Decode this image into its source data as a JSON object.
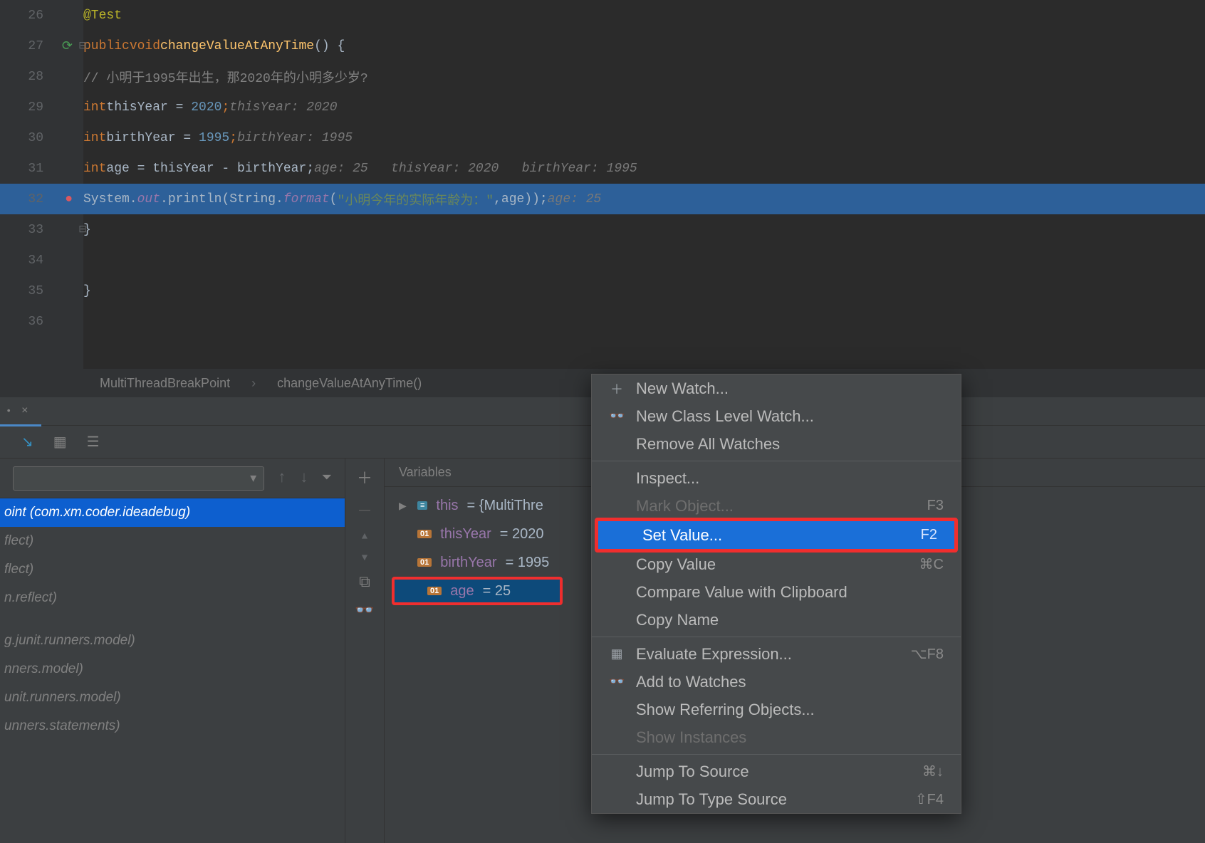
{
  "gutter": {
    "lines": [
      "26",
      "27",
      "28",
      "29",
      "30",
      "31",
      "32",
      "33",
      "34",
      "35",
      "36"
    ]
  },
  "code": {
    "l26": "@Test",
    "l27_kw1": "public",
    "l27_kw2": "void",
    "l27_fn": "changeValueAtAnyTime",
    "l27_tail": "() {",
    "l28_com": "// 小明于1995年出生，那2020年的小明多少岁?",
    "l29_kw": "int",
    "l29_id": "thisYear = ",
    "l29_num": "2020",
    "l29_sc": ";",
    "l29_h": "thisYear: 2020",
    "l30_kw": "int",
    "l30_id": "birthYear = ",
    "l30_num": "1995",
    "l30_sc": ";",
    "l30_h": "birthYear: 1995",
    "l31_kw": "int",
    "l31_id": "age = thisYear - birthYear;",
    "l31_h": "age: 25   thisYear: 2020   birthYear: 1995",
    "l32_a": "System.",
    "l32_out": "out",
    "l32_b": ".println(String.",
    "l32_fmt": "format",
    "l32_c": "(",
    "l32_str": "\"小明今年的实际年龄为：\"",
    "l32_d": ",age));",
    "l32_h": "age: 25",
    "l33": "}",
    "l35": "}"
  },
  "breadcrumb": {
    "a": "MultiThreadBreakPoint",
    "sep": "›",
    "b": "changeValueAtAnyTime()"
  },
  "vars_title": "Variables",
  "vars": {
    "this_name": "this",
    "this_val": " = {MultiThre",
    "y_name": "thisYear",
    "y_val": " = 2020",
    "b_name": "birthYear",
    "b_val": " = 1995",
    "a_name": "age",
    "a_val": " = 25"
  },
  "frames": {
    "sel": "oint (com.xm.coder.ideadebug)",
    "r1": "flect)",
    "r2": "flect)",
    "r3": "n.reflect)",
    "r4": "g.junit.runners.model)",
    "r5": "nners.model)",
    "r6": "unit.runners.model)",
    "r7": "unners.statements)"
  },
  "menu": {
    "new_watch": "New Watch...",
    "new_class": "New Class Level Watch...",
    "remove_all": "Remove All Watches",
    "inspect": "Inspect...",
    "mark": "Mark Object...",
    "mark_sc": "F3",
    "set_value": "Set Value...",
    "set_value_sc": "F2",
    "copy_value": "Copy Value",
    "copy_value_sc": "⌘C",
    "compare": "Compare Value with Clipboard",
    "copy_name": "Copy Name",
    "eval": "Evaluate Expression...",
    "eval_sc": "⌥F8",
    "add_watch": "Add to Watches",
    "show_ref": "Show Referring Objects...",
    "show_inst": "Show Instances",
    "jump_src": "Jump To Source",
    "jump_src_sc": "⌘↓",
    "jump_type": "Jump To Type Source",
    "jump_type_sc": "⇧F4"
  }
}
